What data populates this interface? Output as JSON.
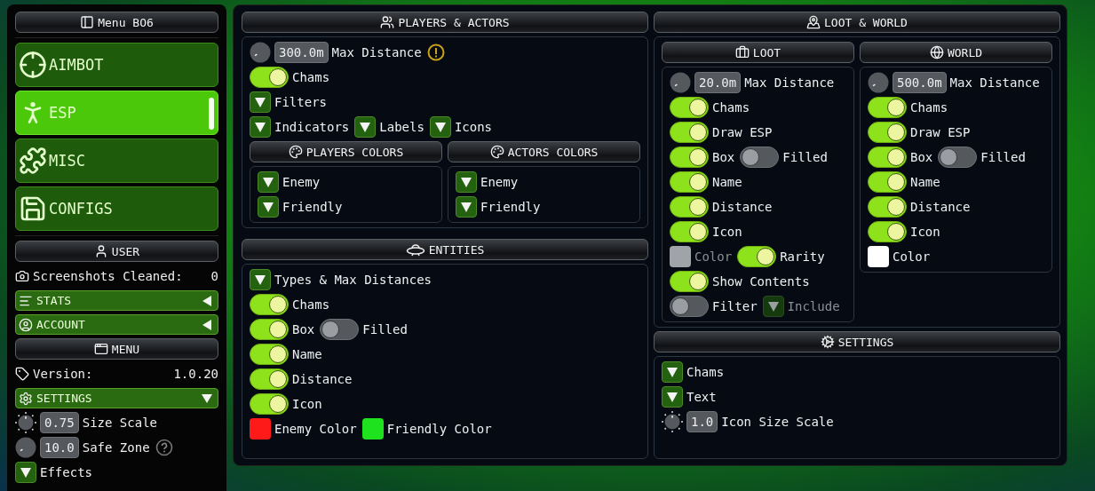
{
  "sidebar": {
    "title": "Menu BO6",
    "nav": [
      {
        "label": "AIMBOT",
        "selected": false
      },
      {
        "label": "ESP",
        "selected": true
      },
      {
        "label": "MISC",
        "selected": false
      },
      {
        "label": "CONFIGS",
        "selected": false
      }
    ],
    "user_header": "USER",
    "screenshots": {
      "label": "Screenshots Cleaned:",
      "value": "0"
    },
    "sections": [
      {
        "label": "STATS",
        "expanded": false
      },
      {
        "label": "ACCOUNT",
        "expanded": false
      }
    ],
    "menu_header": "MENU",
    "version": {
      "label": "Version:",
      "value": "1.0.20"
    },
    "settings": {
      "label": "SETTINGS",
      "expanded": true
    },
    "rows": [
      [
        {
          "kind": "dial",
          "value": "0.75",
          "label": "Size Scale"
        }
      ],
      [
        {
          "kind": "knob",
          "value": "10.0",
          "label": "Safe Zone"
        },
        {
          "kind": "help"
        }
      ],
      [
        {
          "kind": "dropdown",
          "label": "Effects"
        }
      ]
    ]
  },
  "players_actors": {
    "title": "PLAYERS & ACTORS",
    "rows": [
      [
        {
          "kind": "knob",
          "value": "300.0m",
          "label": "Max Distance"
        },
        {
          "kind": "warning"
        }
      ],
      [
        {
          "kind": "toggle",
          "label": "Chams",
          "on": true
        }
      ],
      [
        {
          "kind": "dropdown",
          "label": "Filters"
        }
      ],
      [
        {
          "kind": "dropdown",
          "label": "Indicators"
        },
        {
          "kind": "dropdown",
          "label": "Labels"
        },
        {
          "kind": "dropdown",
          "label": "Icons"
        }
      ]
    ],
    "color_groups": [
      {
        "title": "PLAYERS COLORS",
        "rows": [
          [
            {
              "kind": "dropdown",
              "label": "Enemy"
            }
          ],
          [
            {
              "kind": "dropdown",
              "label": "Friendly"
            }
          ]
        ]
      },
      {
        "title": "ACTORS COLORS",
        "rows": [
          [
            {
              "kind": "dropdown",
              "label": "Enemy"
            }
          ],
          [
            {
              "kind": "dropdown",
              "label": "Friendly"
            }
          ]
        ]
      }
    ]
  },
  "entities": {
    "title": "ENTITIES",
    "rows": [
      [
        {
          "kind": "dropdown",
          "label": "Types & Max Distances"
        }
      ],
      [
        {
          "kind": "toggle",
          "label": "Chams",
          "on": true
        }
      ],
      [
        {
          "kind": "toggle",
          "label": "Box",
          "on": true
        },
        {
          "kind": "toggle",
          "label": "Filled",
          "on": false
        }
      ],
      [
        {
          "kind": "toggle",
          "label": "Name",
          "on": true
        }
      ],
      [
        {
          "kind": "toggle",
          "label": "Distance",
          "on": true
        }
      ],
      [
        {
          "kind": "toggle",
          "label": "Icon",
          "on": true
        }
      ],
      [
        {
          "kind": "swatch",
          "label": "Enemy Color",
          "color": "#ff1a1a"
        },
        {
          "kind": "swatch",
          "label": "Friendly Color",
          "color": "#1ee21e"
        }
      ]
    ]
  },
  "loot_world": {
    "title": "LOOT & WORLD",
    "panels": [
      {
        "title": "LOOT",
        "rows": [
          [
            {
              "kind": "knob",
              "value": "20.0m",
              "label": "Max Distance"
            }
          ],
          [
            {
              "kind": "toggle",
              "label": "Chams",
              "on": true
            }
          ],
          [
            {
              "kind": "toggle",
              "label": "Draw ESP",
              "on": true
            }
          ],
          [
            {
              "kind": "toggle",
              "label": "Box",
              "on": true
            },
            {
              "kind": "toggle",
              "label": "Filled",
              "on": false
            }
          ],
          [
            {
              "kind": "toggle",
              "label": "Name",
              "on": true
            }
          ],
          [
            {
              "kind": "toggle",
              "label": "Distance",
              "on": true
            }
          ],
          [
            {
              "kind": "toggle",
              "label": "Icon",
              "on": true
            }
          ],
          [
            {
              "kind": "swatch",
              "label": "Color",
              "color": "#a0a3a8",
              "disabled": true
            },
            {
              "kind": "toggle",
              "label": "Rarity",
              "on": true
            }
          ],
          [
            {
              "kind": "toggle",
              "label": "Show Contents",
              "on": true
            }
          ],
          [
            {
              "kind": "toggle",
              "label": "Filter",
              "on": false
            },
            {
              "kind": "dropdown",
              "label": "Include",
              "disabled": true
            }
          ]
        ]
      },
      {
        "title": "WORLD",
        "rows": [
          [
            {
              "kind": "knob",
              "value": "500.0m",
              "label": "Max Distance"
            }
          ],
          [
            {
              "kind": "toggle",
              "label": "Chams",
              "on": true
            }
          ],
          [
            {
              "kind": "toggle",
              "label": "Draw ESP",
              "on": true
            }
          ],
          [
            {
              "kind": "toggle",
              "label": "Box",
              "on": true
            },
            {
              "kind": "toggle",
              "label": "Filled",
              "on": false
            }
          ],
          [
            {
              "kind": "toggle",
              "label": "Name",
              "on": true
            }
          ],
          [
            {
              "kind": "toggle",
              "label": "Distance",
              "on": true
            }
          ],
          [
            {
              "kind": "toggle",
              "label": "Icon",
              "on": true
            }
          ],
          [
            {
              "kind": "swatch",
              "label": "Color",
              "color": "#ffffff"
            }
          ]
        ]
      }
    ]
  },
  "settings": {
    "title": "SETTINGS",
    "rows": [
      [
        {
          "kind": "dropdown",
          "label": "Chams"
        }
      ],
      [
        {
          "kind": "dropdown",
          "label": "Text"
        }
      ],
      [
        {
          "kind": "dial",
          "value": "1.0",
          "label": "Icon Size Scale"
        }
      ]
    ]
  }
}
